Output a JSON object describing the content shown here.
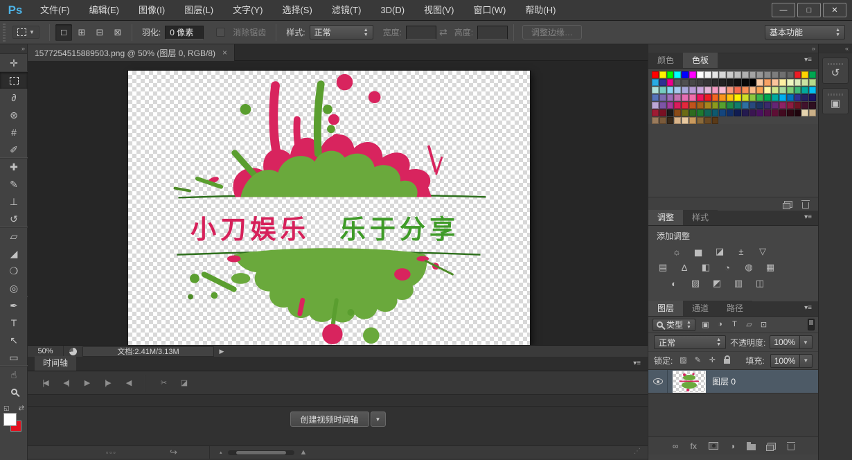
{
  "app": {
    "logo": "Ps",
    "menu": [
      "文件(F)",
      "编辑(E)",
      "图像(I)",
      "图层(L)",
      "文字(Y)",
      "选择(S)",
      "滤镜(T)",
      "3D(D)",
      "视图(V)",
      "窗口(W)",
      "帮助(H)"
    ],
    "window_buttons": [
      {
        "name": "minimize-button",
        "glyph": "—"
      },
      {
        "name": "maximize-button",
        "glyph": "□"
      },
      {
        "name": "close-button",
        "glyph": "✕"
      }
    ]
  },
  "options": {
    "mode_buttons": [
      {
        "name": "new-selection-button",
        "glyph": "□",
        "cls": "active"
      },
      {
        "name": "add-to-selection-button",
        "glyph": "⊞",
        "cls": ""
      },
      {
        "name": "subtract-from-selection-button",
        "glyph": "⊟",
        "cls": ""
      },
      {
        "name": "intersect-selection-button",
        "glyph": "⊠",
        "cls": ""
      }
    ],
    "feather_label": "羽化:",
    "feather_value": "0 像素",
    "antialias_label": "消除锯齿",
    "style_label": "样式:",
    "style_value": "正常",
    "width_label": "宽度:",
    "height_label": "高度:",
    "refine_edge_label": "调整边缘…",
    "workspace_value": "基本功能"
  },
  "toolbar": {
    "collapse_glyph": "»",
    "tools": [
      {
        "name": "move-tool",
        "glyph": "✛",
        "cls": "",
        "css": ""
      },
      {
        "name": "rectangular-marquee-tool",
        "glyph": "",
        "cls": "grp selected",
        "css": "marquee-box"
      },
      {
        "name": "lasso-tool",
        "glyph": "∂",
        "cls": "",
        "css": ""
      },
      {
        "name": "quick-selection-tool",
        "glyph": "⊛",
        "cls": "",
        "css": ""
      },
      {
        "name": "crop-tool",
        "glyph": "#",
        "cls": "",
        "css": ""
      },
      {
        "name": "eyedropper-tool",
        "glyph": "✐",
        "cls": "",
        "css": ""
      },
      {
        "name": "spot-healing-brush-tool",
        "glyph": "✚",
        "cls": "grp",
        "css": ""
      },
      {
        "name": "brush-tool",
        "glyph": "✎",
        "cls": "",
        "css": ""
      },
      {
        "name": "clone-stamp-tool",
        "glyph": "⊥",
        "cls": "",
        "css": ""
      },
      {
        "name": "history-brush-tool",
        "glyph": "↺",
        "cls": "",
        "css": ""
      },
      {
        "name": "eraser-tool",
        "glyph": "▱",
        "cls": "grp",
        "css": ""
      },
      {
        "name": "paint-bucket-tool",
        "glyph": "◢",
        "cls": "",
        "css": ""
      },
      {
        "name": "blur-tool",
        "glyph": "❍",
        "cls": "",
        "css": ""
      },
      {
        "name": "dodge-tool",
        "glyph": "◎",
        "cls": "",
        "css": ""
      },
      {
        "name": "pen-tool",
        "glyph": "✒",
        "cls": "grp",
        "css": ""
      },
      {
        "name": "type-tool",
        "glyph": "T",
        "cls": "",
        "css": ""
      },
      {
        "name": "path-selection-tool",
        "glyph": "↖",
        "cls": "",
        "css": ""
      },
      {
        "name": "rectangle-tool",
        "glyph": "▭",
        "cls": "",
        "css": ""
      },
      {
        "name": "hand-tool",
        "glyph": "☝",
        "cls": "grp",
        "css": ""
      },
      {
        "name": "zoom-tool",
        "glyph": "",
        "cls": "",
        "css": "mag"
      }
    ],
    "default_colors_glyph": "◱",
    "swap_colors_glyph": "⇄",
    "foreground_color": "#ffffff",
    "background_color": "#e3111f"
  },
  "doc": {
    "tab_title": "1577254515889503.png @ 50% (图层 0, RGB/8)",
    "close_glyph": "×"
  },
  "canvas": {
    "title_red": "小刀娱乐",
    "title_green": "乐于分享",
    "red": "#d6215a",
    "green": "#3f9b28"
  },
  "status": {
    "zoom_value": "50%",
    "doc_info": "文档:2.41M/3.13M",
    "expand_glyph": "▶"
  },
  "timeline": {
    "tab_label": "时间轴",
    "menu_glyph": "▾≡",
    "buttons": [
      {
        "name": "first-frame-button",
        "glyph": "|◀",
        "cls": ""
      },
      {
        "name": "previous-frame-button",
        "glyph": "◀|",
        "cls": ""
      },
      {
        "name": "play-button",
        "glyph": "▶",
        "cls": ""
      },
      {
        "name": "next-frame-button",
        "glyph": "|▶",
        "cls": ""
      },
      {
        "name": "mute-audio-button",
        "glyph": "◀",
        "cls": ""
      },
      {
        "name": "split-clip-button",
        "glyph": "✂",
        "cls": "grp"
      },
      {
        "name": "transition-button",
        "glyph": "◪",
        "cls": ""
      }
    ],
    "create_label": "创建视频时间轴",
    "dropdown_glyph": "▼",
    "frames_glyph": "▫▫▫",
    "render_glyph": "↪",
    "zoom_out_glyph": "▴",
    "zoom_in_glyph": "▲",
    "grip_glyph": "⋰"
  },
  "dock": {
    "panel_collapse_glyph": "»",
    "strip_expand_glyph": "«",
    "buttons": [
      {
        "name": "history-panel-button",
        "glyph": "↺"
      },
      {
        "name": "3d-panel-button",
        "glyph": "▣"
      }
    ]
  },
  "panels": {
    "swatches": {
      "tabs": [
        {
          "label": "颜色",
          "cls": ""
        },
        {
          "label": "色板",
          "cls": "active"
        }
      ],
      "menu_glyph": "▾≡",
      "colors": [
        "#ff0000",
        "#fff200",
        "#00ff00",
        "#00ffff",
        "#0000ff",
        "#ff00ff",
        "#ffffff",
        "#f2f2f2",
        "#e5e5e5",
        "#d8d8d8",
        "#cbcbcb",
        "#bebebe",
        "#b1b1b1",
        "#a4a4a4",
        "#979797",
        "#8a8a8a",
        "#7d7d7d",
        "#707070",
        "#636363",
        "#ed1c24",
        "#ffd400",
        "#00a651",
        "#29abe2",
        "#2e3192",
        "#ec008c",
        "#595959",
        "#505050",
        "#474747",
        "#3e3e3e",
        "#353535",
        "#2c2c2c",
        "#232323",
        "#1a1a1a",
        "#111111",
        "#080808",
        "#000000",
        "#f9cba5",
        "#f7a265",
        "#fbc39c",
        "#fff0a3",
        "#eef7c0",
        "#dcebbb",
        "#c9e2a2",
        "#b5d98b",
        "#aee0d8",
        "#76ccc1",
        "#8bd4f2",
        "#a7c9ec",
        "#a9a8da",
        "#b99cd6",
        "#cba8dc",
        "#e4b6d6",
        "#f49ac1",
        "#f6bcd4",
        "#f69a7e",
        "#f26c4f",
        "#f68e55",
        "#fbbb8b",
        "#f7a154",
        "#fff8a8",
        "#cfe58a",
        "#a7d89e",
        "#7ecb76",
        "#3db878",
        "#02a99d",
        "#03bff3",
        "#5674b9",
        "#7c6cb2",
        "#9d6db7",
        "#c273b1",
        "#e56db2",
        "#f06eaa",
        "#ed145b",
        "#ed1c24",
        "#f26522",
        "#f7941d",
        "#ffc20e",
        "#fff200",
        "#cddc29",
        "#8dc63f",
        "#39b54a",
        "#00a651",
        "#00a99e",
        "#00aeef",
        "#0072bc",
        "#2e3192",
        "#262262",
        "#1b1464",
        "#bba7d7",
        "#7d55a6",
        "#a53b9b",
        "#da1c5c",
        "#e3283d",
        "#c1531c",
        "#a8611a",
        "#a8851d",
        "#8b9a1f",
        "#56a02f",
        "#208a45",
        "#107c6c",
        "#2f6fa0",
        "#28497d",
        "#1d3462",
        "#3b2a6c",
        "#652575",
        "#8c2364",
        "#8c1d41",
        "#6e1424",
        "#41122c",
        "#2e0f20",
        "#9e1b33",
        "#7a1023",
        "#1b1b1b",
        "#8a4b17",
        "#6b6b15",
        "#2e6b1f",
        "#1e7a2f",
        "#116656",
        "#0f5a6f",
        "#14457d",
        "#122f67",
        "#101c51",
        "#241a4f",
        "#3a1551",
        "#4a1061",
        "#521049",
        "#5e0e35",
        "#420a1f",
        "#2e0813",
        "#1f050d",
        "#e5d3ae",
        "#cbb088",
        "#9a7b5c",
        "#7a5a3a",
        "#3a2a1a",
        "#d9b48a",
        "#e8c9a0",
        "#c99a5e",
        "#8a6a3a",
        "#6b4a24",
        "#5a3a18"
      ]
    },
    "adjustments": {
      "tabs": [
        {
          "label": "调整",
          "cls": "active"
        },
        {
          "label": "样式",
          "cls": ""
        }
      ],
      "menu_glyph": "▾≡",
      "add_label": "添加调整",
      "row1": [
        {
          "name": "brightness-contrast-icon",
          "glyph": "☼"
        },
        {
          "name": "levels-icon",
          "glyph": "▅"
        },
        {
          "name": "curves-icon",
          "glyph": "◪"
        },
        {
          "name": "exposure-icon",
          "glyph": "±"
        },
        {
          "name": "vibrance-icon",
          "glyph": "▽"
        }
      ],
      "row2": [
        {
          "name": "hue-saturation-icon",
          "glyph": "▤"
        },
        {
          "name": "color-balance-icon",
          "glyph": "∆"
        },
        {
          "name": "black-white-icon",
          "glyph": "◧"
        },
        {
          "name": "photo-filter-icon",
          "glyph": "◔"
        },
        {
          "name": "channel-mixer-icon",
          "glyph": "◍"
        },
        {
          "name": "color-lookup-icon",
          "glyph": "▦"
        }
      ],
      "row3": [
        {
          "name": "invert-icon",
          "glyph": "◐"
        },
        {
          "name": "posterize-icon",
          "glyph": "▨"
        },
        {
          "name": "threshold-icon",
          "glyph": "◩"
        },
        {
          "name": "gradient-map-icon",
          "glyph": "▥"
        },
        {
          "name": "selective-color-icon",
          "glyph": "◫"
        }
      ]
    },
    "layers": {
      "tabs": [
        {
          "label": "图层",
          "cls": "active"
        },
        {
          "label": "通道",
          "cls": ""
        },
        {
          "label": "路径",
          "cls": ""
        }
      ],
      "menu_glyph": "▾≡",
      "type_label": "类型",
      "filter_icons": [
        {
          "name": "filter-pixel-layers-icon",
          "glyph": "▣"
        },
        {
          "name": "filter-adjustment-layers-icon",
          "glyph": "◑"
        },
        {
          "name": "filter-type-layers-icon",
          "glyph": "T"
        },
        {
          "name": "filter-shape-layers-icon",
          "glyph": "▱"
        },
        {
          "name": "filter-smart-objects-icon",
          "glyph": "⊡"
        }
      ],
      "blend_value": "正常",
      "opacity_label": "不透明度:",
      "opacity_value": "100%",
      "lock_label": "锁定:",
      "lock_icons": [
        {
          "name": "lock-transparent-pixels-icon",
          "glyph": "▨",
          "css": ""
        },
        {
          "name": "lock-image-pixels-icon",
          "glyph": "✎",
          "css": ""
        },
        {
          "name": "lock-position-icon",
          "glyph": "✛",
          "css": ""
        },
        {
          "name": "lock-all-icon",
          "glyph": "",
          "css": "lockpad"
        }
      ],
      "fill_label": "填充:",
      "fill_value": "100%",
      "layer_name": "图层 0",
      "bottom_icons": [
        {
          "name": "link-layers-icon",
          "glyph": "∞",
          "css": ""
        },
        {
          "name": "layer-style-icon",
          "glyph": "fx",
          "css": ""
        },
        {
          "name": "add-layer-mask-icon",
          "glyph": "",
          "css": "maskicon"
        },
        {
          "name": "new-adjustment-layer-icon",
          "glyph": "◑",
          "css": ""
        },
        {
          "name": "new-group-icon",
          "glyph": "",
          "css": "foldericon"
        },
        {
          "name": "new-layer-icon",
          "glyph": "",
          "css": "pageicon"
        },
        {
          "name": "delete-layer-icon",
          "glyph": "",
          "css": "trashicon"
        }
      ]
    }
  }
}
